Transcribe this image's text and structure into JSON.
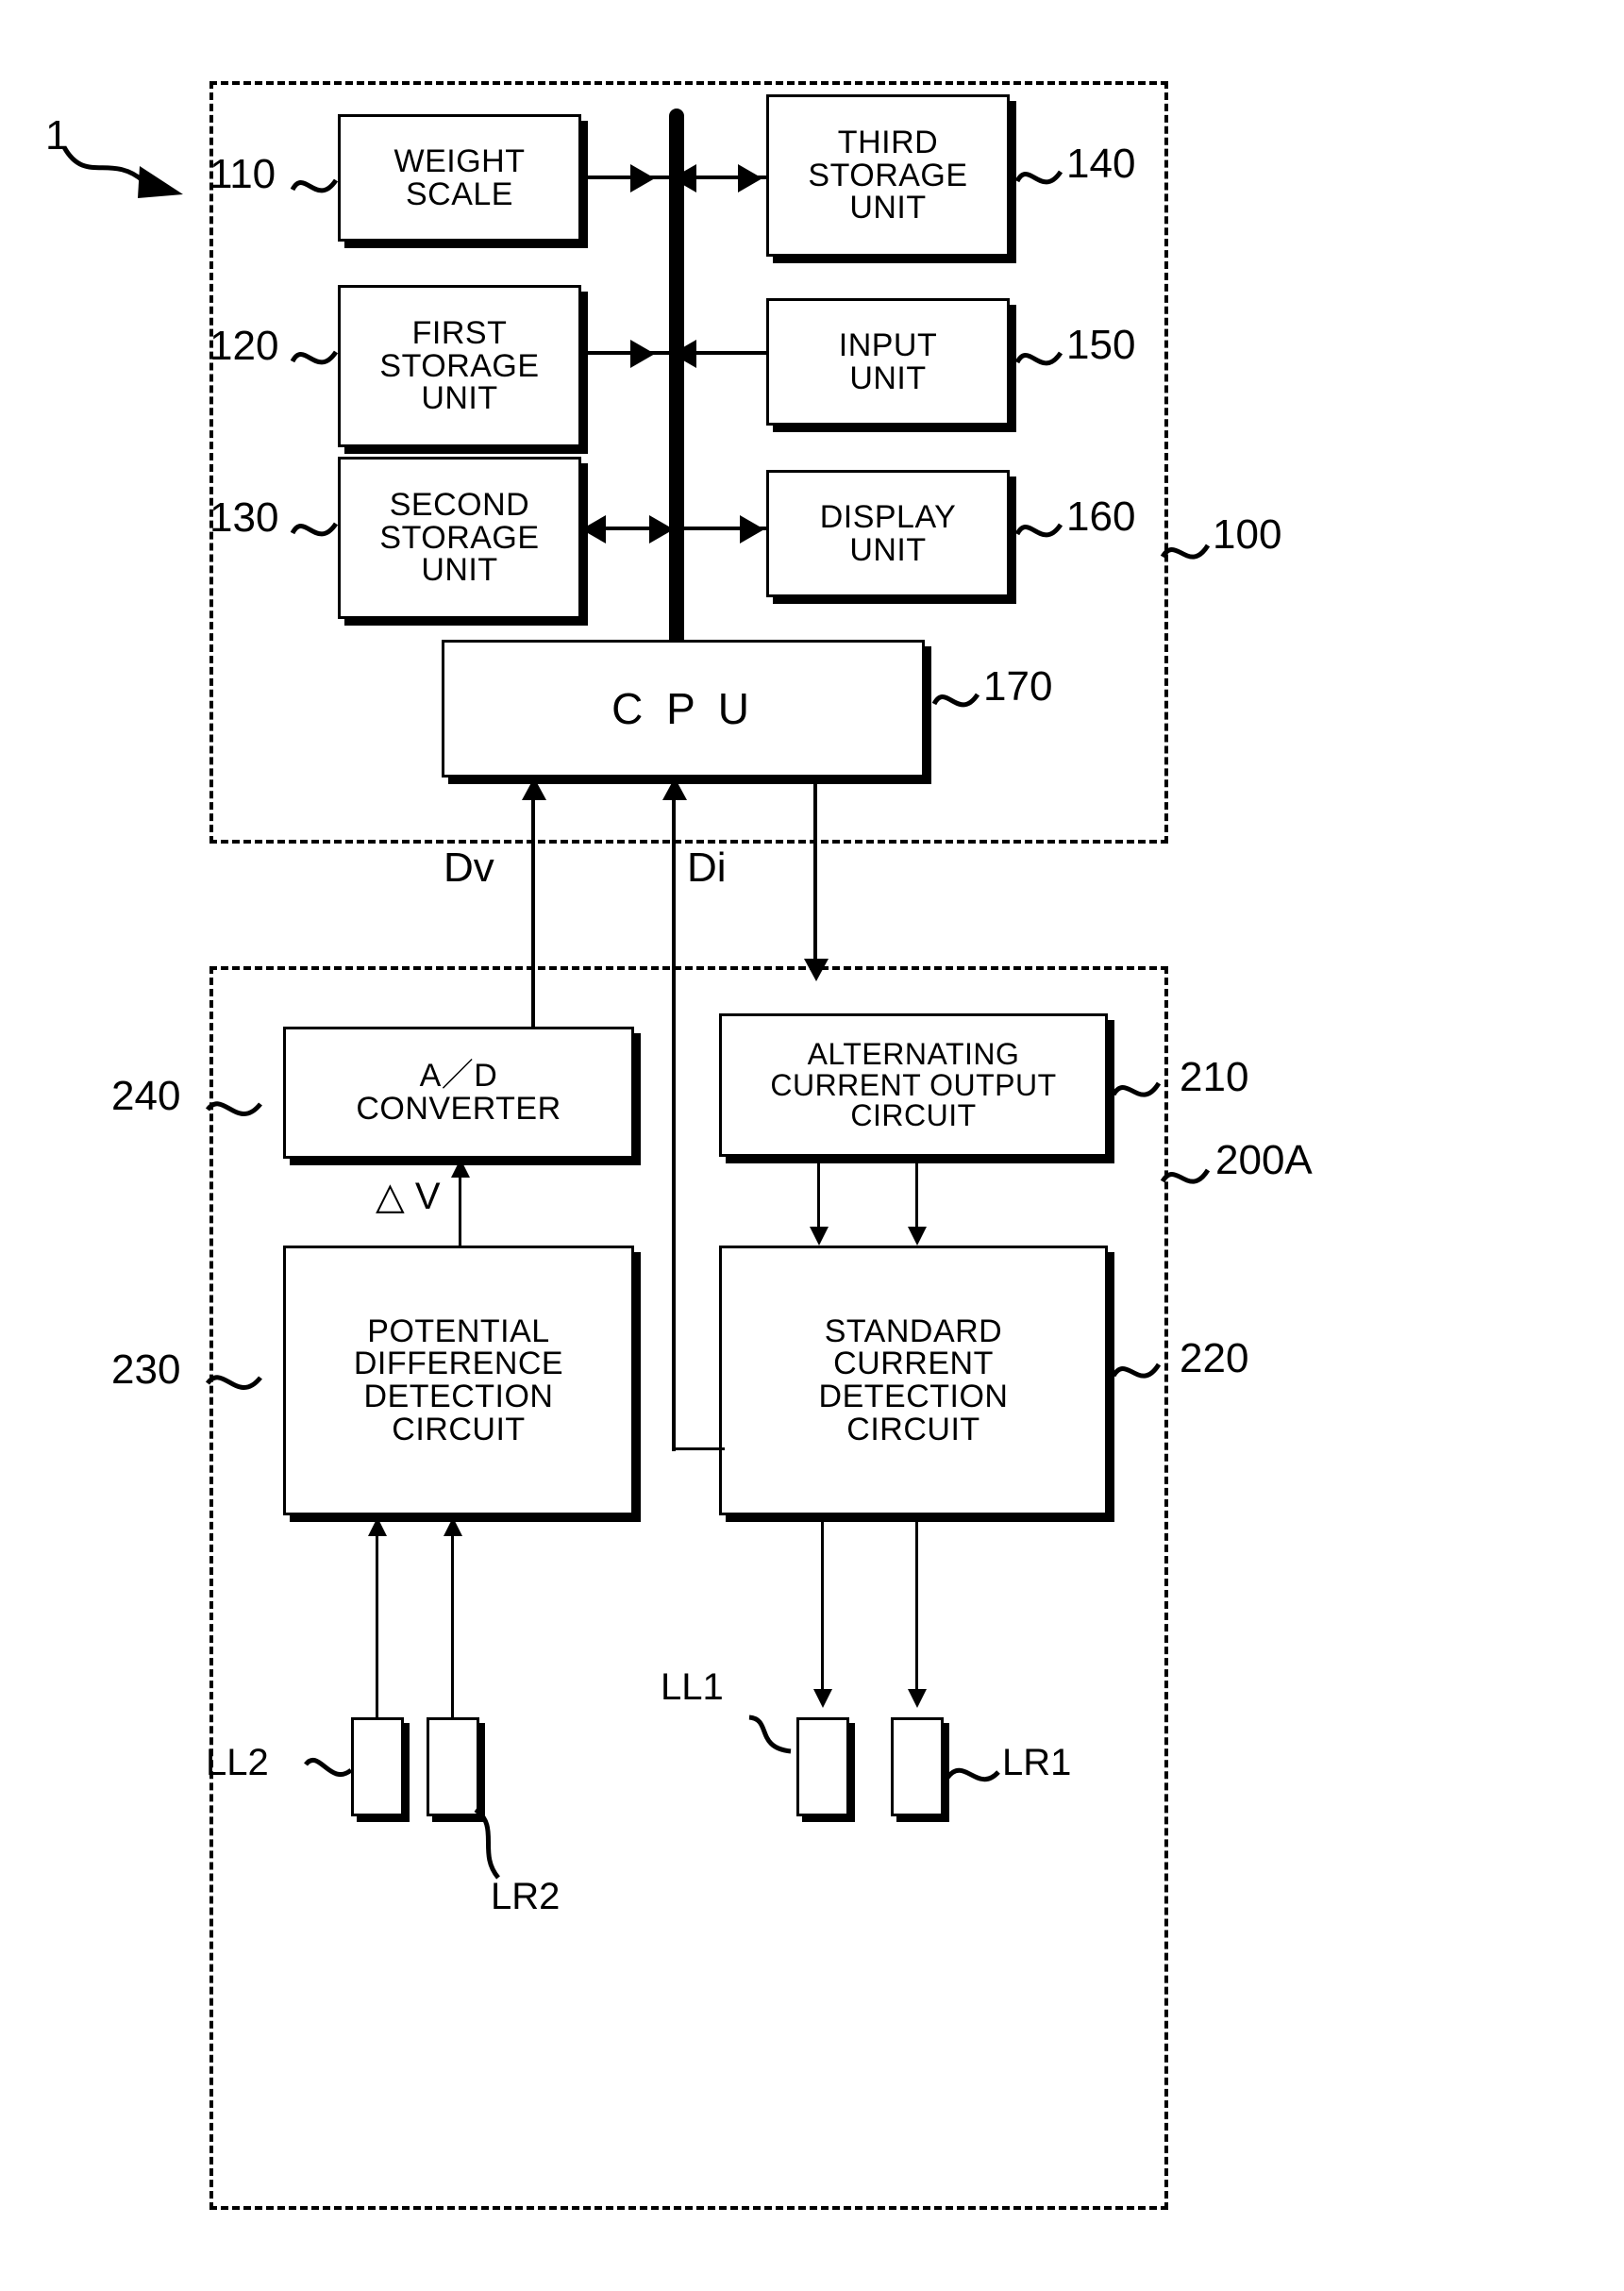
{
  "figure": {
    "overall_ref": "1"
  },
  "upper_group": {
    "ref": "100",
    "blocks": [
      {
        "id": "weight-scale",
        "ref": "110",
        "label": "WEIGHT\nSCALE"
      },
      {
        "id": "first-storage",
        "ref": "120",
        "label": "FIRST\nSTORAGE\nUNIT"
      },
      {
        "id": "second-storage",
        "ref": "130",
        "label": "SECOND\nSTORAGE\nUNIT"
      },
      {
        "id": "third-storage",
        "ref": "140",
        "label": "THIRD\nSTORAGE\nUNIT"
      },
      {
        "id": "input-unit",
        "ref": "150",
        "label": "INPUT\nUNIT"
      },
      {
        "id": "display-unit",
        "ref": "160",
        "label": "DISPLAY\nUNIT"
      },
      {
        "id": "cpu",
        "ref": "170",
        "label": "C  P  U"
      }
    ]
  },
  "signals": {
    "dv": "Dv",
    "di": "Di",
    "delta_v": "△ V"
  },
  "lower_group": {
    "ref": "200A",
    "blocks": [
      {
        "id": "ad-converter",
        "ref": "240",
        "label": "A／D\nCONVERTER"
      },
      {
        "id": "ac-output-circuit",
        "ref": "210",
        "label": "ALTERNATING\nCURRENT OUTPUT\nCIRCUIT"
      },
      {
        "id": "potential-diff",
        "ref": "230",
        "label": "POTENTIAL\nDIFFERENCE\nDETECTION\nCIRCUIT"
      },
      {
        "id": "standard-current",
        "ref": "220",
        "label": "STANDARD\nCURRENT\nDETECTION\nCIRCUIT"
      }
    ],
    "electrodes": [
      {
        "id": "electrode-ll2",
        "label": "LL2"
      },
      {
        "id": "electrode-lr2",
        "label": "LR2"
      },
      {
        "id": "electrode-ll1",
        "label": "LL1"
      },
      {
        "id": "electrode-lr1",
        "label": "LR1"
      }
    ]
  },
  "colors": {
    "ink": "#000000",
    "paper": "#ffffff"
  }
}
